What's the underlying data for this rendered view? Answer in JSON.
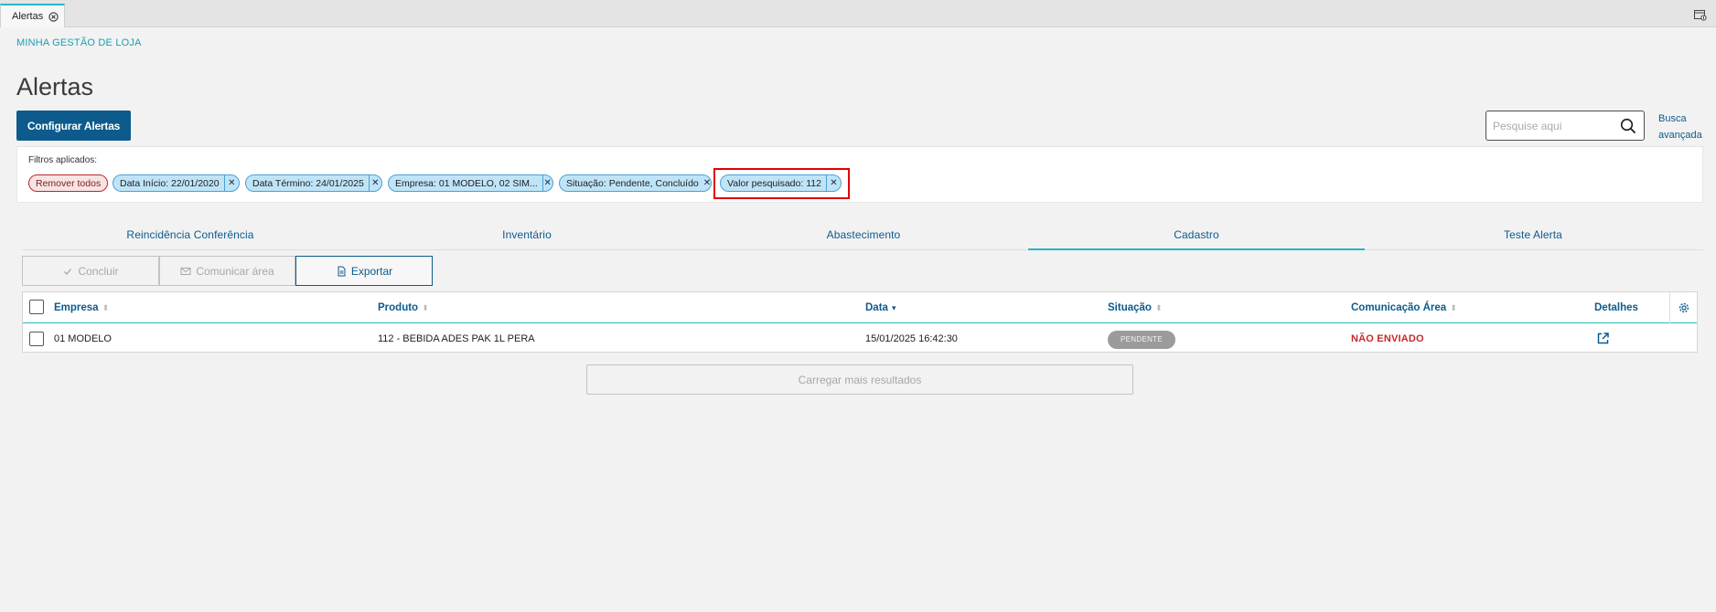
{
  "window": {
    "tab_label": "Alertas",
    "tab_close_icon": "close-circle-icon",
    "corner_icon": "window-options-icon"
  },
  "breadcrumb": "MINHA GESTÃO DE LOJA",
  "page_title": "Alertas",
  "toolbar": {
    "configure_label": "Configurar Alertas",
    "search_placeholder": "Pesquise aqui",
    "search_icon": "magnifier-icon",
    "advanced_search_label": "Busca avançada"
  },
  "filters": {
    "label": "Filtros aplicados:",
    "remove_all": "Remover todos",
    "chips": [
      {
        "label": "Data Início: 22/01/2020"
      },
      {
        "label": "Data Término: 24/01/2025"
      },
      {
        "label": "Empresa: 01 MODELO, 02 SIM..."
      },
      {
        "label": "Situação: Pendente, Concluído"
      },
      {
        "label": "Valor pesquisado: 112"
      }
    ],
    "highlight_color": "#e00000"
  },
  "tabs": [
    {
      "label": "Reincidência Conferência",
      "active": false
    },
    {
      "label": "Inventário",
      "active": false
    },
    {
      "label": "Abastecimento",
      "active": false
    },
    {
      "label": "Cadastro",
      "active": true
    },
    {
      "label": "Teste Alerta",
      "active": false
    }
  ],
  "actions": {
    "conclude_label": "Concluir",
    "communicate_label": "Comunicar área",
    "export_label": "Exportar"
  },
  "table": {
    "columns": [
      "Empresa",
      "Produto",
      "Data",
      "Situação",
      "Comunicação Área",
      "Detalhes"
    ],
    "rows": [
      {
        "empresa": "01 MODELO",
        "produto": "112 - BEBIDA ADES PAK 1L PERA",
        "data": "15/01/2025 16:42:30",
        "situacao": "PENDENTE",
        "comunicacao": "NÃO ENVIADO"
      }
    ]
  },
  "load_more_label": "Carregar mais resultados",
  "colors": {
    "primary": "#0c5b8c",
    "accent": "#29b6c5",
    "danger": "#c52a2a",
    "chip_fill": "#bfe4f7"
  }
}
